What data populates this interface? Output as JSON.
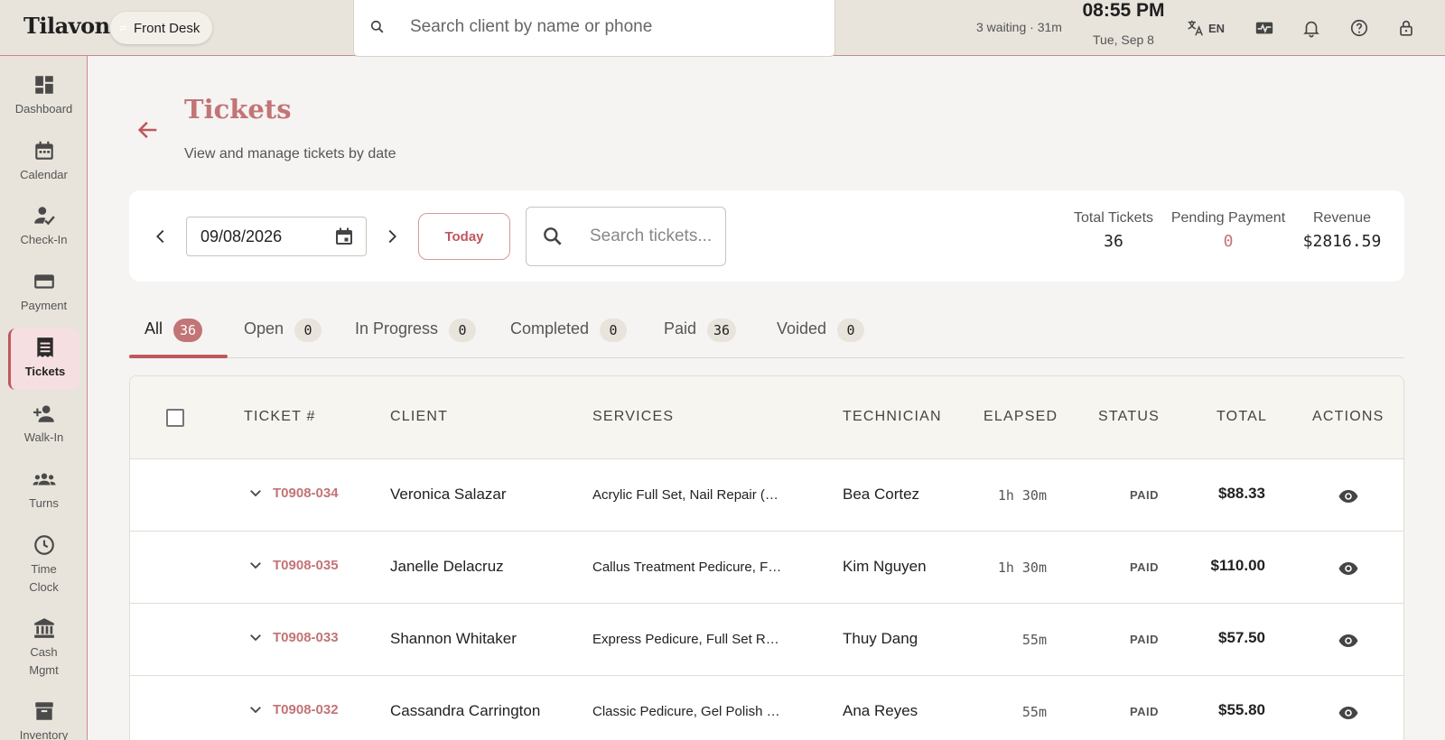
{
  "header": {
    "brand": "Tilavon",
    "role": "Front Desk",
    "search_placeholder": "Search client by name or phone",
    "waiting": "3 waiting · 31m",
    "time": "08:55 PM",
    "date": "Tue, Sep 8",
    "language": "EN",
    "icons": [
      "translate-icon",
      "activity-icon",
      "bell-icon",
      "help-icon",
      "lock-icon"
    ]
  },
  "sidebar": {
    "items": [
      {
        "label": "Dashboard",
        "icon": "dashboard-icon"
      },
      {
        "label": "Calendar",
        "icon": "calendar-icon"
      },
      {
        "label": "Check-In",
        "icon": "check-in-icon"
      },
      {
        "label": "Payment",
        "icon": "card-icon"
      },
      {
        "label": "Tickets",
        "icon": "receipt-icon",
        "active": true
      },
      {
        "label": "Walk-In",
        "icon": "person-add-icon"
      },
      {
        "label": "Turns",
        "icon": "group-icon"
      },
      {
        "label": "Time Clock",
        "icon": "clock-icon"
      },
      {
        "label": "Cash Mgmt",
        "icon": "bank-icon"
      },
      {
        "label": "Inventory",
        "icon": "archive-icon"
      }
    ]
  },
  "page": {
    "title": "Tickets",
    "subtitle": "View and manage tickets by date"
  },
  "toolbar": {
    "date": "09/08/2026",
    "today_label": "Today",
    "search_placeholder": "Search tickets...",
    "stats": {
      "total_label": "Total Tickets",
      "total_value": "36",
      "pending_label": "Pending Payment",
      "pending_value": "0",
      "revenue_label": "Revenue",
      "revenue_value": "$2816.59"
    }
  },
  "tabs": [
    {
      "label": "All",
      "count": "36",
      "active": true
    },
    {
      "label": "Open",
      "count": "0"
    },
    {
      "label": "In Progress",
      "count": "0"
    },
    {
      "label": "Completed",
      "count": "0"
    },
    {
      "label": "Paid",
      "count": "36"
    },
    {
      "label": "Voided",
      "count": "0"
    }
  ],
  "table": {
    "columns": [
      "TICKET #",
      "CLIENT",
      "SERVICES",
      "TECHNICIAN",
      "ELAPSED",
      "STATUS",
      "TOTAL",
      "ACTIONS"
    ],
    "rows": [
      {
        "ticket": "T0908-034",
        "client": "Veronica Salazar",
        "services": "Acrylic Full Set, Nail Repair (…",
        "technician": "Bea Cortez",
        "elapsed": "1h 30m",
        "status": "PAID",
        "total": "$88.33"
      },
      {
        "ticket": "T0908-035",
        "client": "Janelle Delacruz",
        "services": "Callus Treatment Pedicure, F…",
        "technician": "Kim Nguyen",
        "elapsed": "1h 30m",
        "status": "PAID",
        "total": "$110.00"
      },
      {
        "ticket": "T0908-033",
        "client": "Shannon Whitaker",
        "services": "Express Pedicure, Full Set R…",
        "technician": "Thuy Dang",
        "elapsed": "55m",
        "status": "PAID",
        "total": "$57.50"
      },
      {
        "ticket": "T0908-032",
        "client": "Cassandra Carrington",
        "services": "Classic Pedicure, Gel Polish …",
        "technician": "Ana Reyes",
        "elapsed": "55m",
        "status": "PAID",
        "total": "$55.80"
      }
    ]
  },
  "colors": {
    "accent": "#c0575d",
    "accent_soft": "#c27476",
    "chrome": "#e8e4dc"
  }
}
